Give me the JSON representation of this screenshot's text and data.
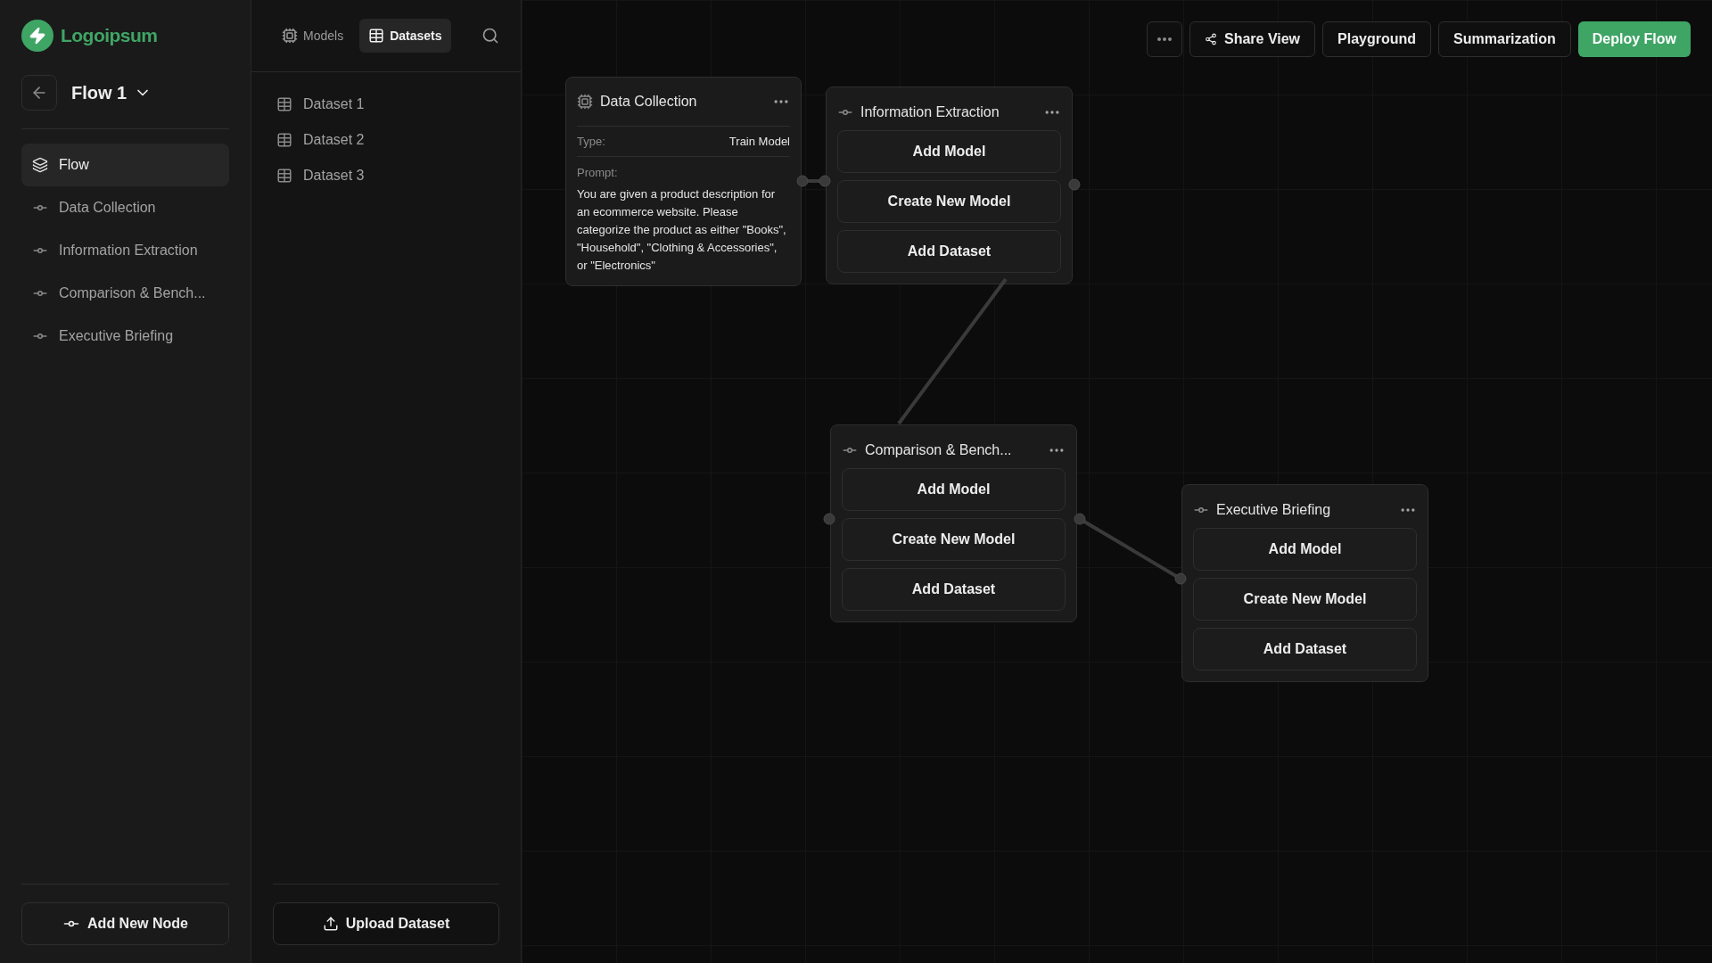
{
  "brand": {
    "name": "Logoipsum"
  },
  "flow": {
    "title": "Flow 1"
  },
  "sidebar": {
    "items": [
      {
        "kind": "flow",
        "label": "Flow",
        "selected": true
      },
      {
        "kind": "node",
        "label": "Data Collection",
        "selected": false
      },
      {
        "kind": "node",
        "label": "Information Extraction",
        "selected": false
      },
      {
        "kind": "node",
        "label": "Comparison & Bench...",
        "selected": false
      },
      {
        "kind": "node",
        "label": "Executive Briefing",
        "selected": false
      }
    ],
    "add_button": "Add New Node"
  },
  "library": {
    "tabs": [
      {
        "kind": "models",
        "label": "Models",
        "selected": false
      },
      {
        "kind": "datasets",
        "label": "Datasets",
        "selected": true
      }
    ],
    "items": [
      "Dataset 1",
      "Dataset 2",
      "Dataset 3"
    ],
    "upload_button": "Upload Dataset"
  },
  "toolbar": {
    "buttons": [
      {
        "kind": "share",
        "label": "Share View"
      },
      {
        "kind": "plain",
        "label": "Playground"
      },
      {
        "kind": "plain",
        "label": "Summarization"
      },
      {
        "kind": "primary",
        "label": "Deploy Flow"
      }
    ]
  },
  "canvas": {
    "nodes": [
      {
        "kind": "config",
        "title": "Data Collection",
        "type_label": "Type:",
        "type_value": "Train Model",
        "prompt_label": "Prompt:",
        "prompt": "You are given a product description for an ecommerce website. Please categorize the product as either \"Books\", \"Household\", \"Clothing & Accessories\", or \"Electronics\""
      },
      {
        "kind": "model",
        "title": "Information Extraction",
        "actions": [
          "Add Model",
          "Create New Model",
          "Add Dataset"
        ]
      },
      {
        "kind": "model",
        "title": "Comparison & Bench...",
        "actions": [
          "Add Model",
          "Create New Model",
          "Add Dataset"
        ]
      },
      {
        "kind": "model",
        "title": "Executive Briefing",
        "actions": [
          "Add Model",
          "Create New Model",
          "Add Dataset"
        ]
      }
    ]
  }
}
